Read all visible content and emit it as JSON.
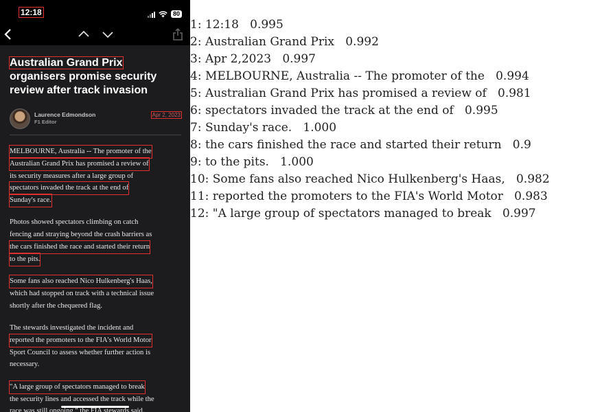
{
  "phone": {
    "status_bar": {
      "time": "12:18",
      "battery": "80",
      "icons": [
        "signal-icon",
        "wifi-icon",
        "battery-icon"
      ]
    },
    "nav": {
      "icons": [
        "back-icon",
        "chevron-up-icon",
        "chevron-down-icon",
        "share-icon"
      ]
    },
    "article": {
      "headline": [
        "Australian Grand Prix",
        "organisers promise security",
        "review after track invasion"
      ],
      "author_name": "Laurence Edmondson",
      "author_role": "F1 Editor",
      "date": "Apr 2, 2023",
      "paragraphs": [
        [
          "MELBOURNE, Australia -- The promoter of the",
          "Australian Grand Prix has promised a review of",
          "its security measures after a large group of",
          "spectators invaded the track at the end of",
          "Sunday's race."
        ],
        [
          "Photos showed spectators climbing on catch",
          "fencing and straying beyond the crash barriers as",
          "the cars finished the race and started their return",
          "to the pits."
        ],
        [
          "Some fans also reached Nico Hulkenberg's Haas,",
          "which had stopped on track with a technical issue",
          "shortly after the chequered flag."
        ],
        [
          "The stewards investigated the incident and",
          "reported the promoters to the FIA's World Motor",
          "Sport Council to assess whether further action is",
          "necessary."
        ],
        [
          "\"A large group of spectators managed to break",
          "the security lines and accessed the track while the",
          "race was still ongoing,\" the FIA stewards said."
        ]
      ]
    },
    "colors": {
      "background": "#1c1c1e",
      "highlight_box": "#e03030"
    }
  },
  "ocr_results": [
    "1: 12:18   0.995",
    "2: Australian Grand Prix   0.992",
    "3: Apr 2,2023   0.997",
    "4: MELBOURNE, Australia -- The promoter of the   0.994",
    "5: Australian Grand Prix has promised a review of   0.981",
    "6: spectators invaded the track at the end of   0.995",
    "7: Sunday's race.   1.000",
    "8: the cars finished the race and started their return   0.9",
    "9: to the pits.   1.000",
    "10: Some fans also reached Nico Hulkenberg's Haas,   0.982",
    "11: reported the promoters to the FIA's World Motor   0.983",
    "12: \"A large group of spectators managed to break   0.997"
  ]
}
